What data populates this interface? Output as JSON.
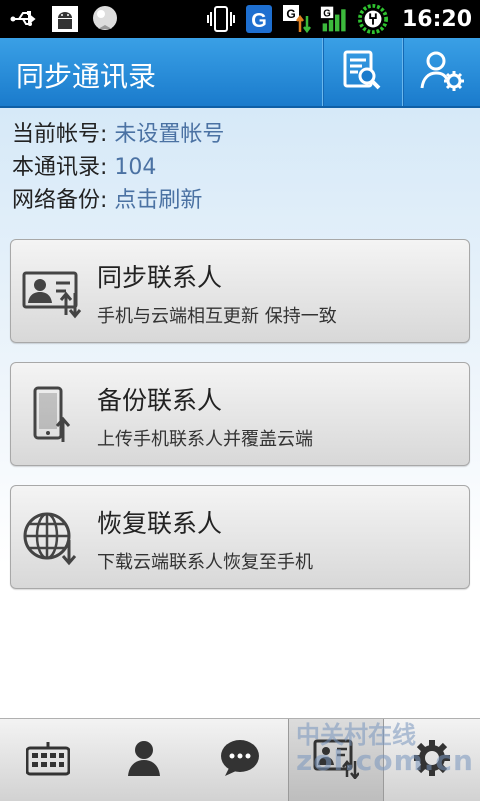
{
  "status_bar": {
    "time": "16:20",
    "icons_left": [
      "usb-icon",
      "android-debug-icon",
      "notification-ball-icon"
    ],
    "icons_right": [
      "vibrate-icon",
      "g-app-icon",
      "g-data-icon",
      "signal-icon",
      "battery-charging-icon"
    ]
  },
  "header": {
    "title": "同步通讯录",
    "buttons": [
      "search-log-icon",
      "account-settings-icon"
    ]
  },
  "info": {
    "account_label": "当前帐号: ",
    "account_value": "未设置帐号",
    "contacts_label": "本通讯录: ",
    "contacts_value": "104",
    "backup_label": "网络备份: ",
    "backup_value": "点击刷新"
  },
  "actions": [
    {
      "title": "同步联系人",
      "desc": "手机与云端相互更新 保持一致",
      "icon": "sync-contacts-icon"
    },
    {
      "title": "备份联系人",
      "desc": "上传手机联系人并覆盖云端",
      "icon": "backup-phone-icon"
    },
    {
      "title": "恢复联系人",
      "desc": "下载云端联系人恢复至手机",
      "icon": "restore-globe-icon"
    }
  ],
  "tabs": [
    {
      "name": "dialpad",
      "icon": "keypad-icon"
    },
    {
      "name": "contacts",
      "icon": "person-icon"
    },
    {
      "name": "messages",
      "icon": "message-bubble-icon"
    },
    {
      "name": "sync",
      "icon": "contact-card-sync-icon",
      "active": true
    },
    {
      "name": "settings",
      "icon": "gear-icon"
    }
  ],
  "watermark": {
    "line1": "中关村在线",
    "line2": "zol.com.cn"
  },
  "colors": {
    "header": "#1a7bcc",
    "value_text": "#4b72a3"
  }
}
